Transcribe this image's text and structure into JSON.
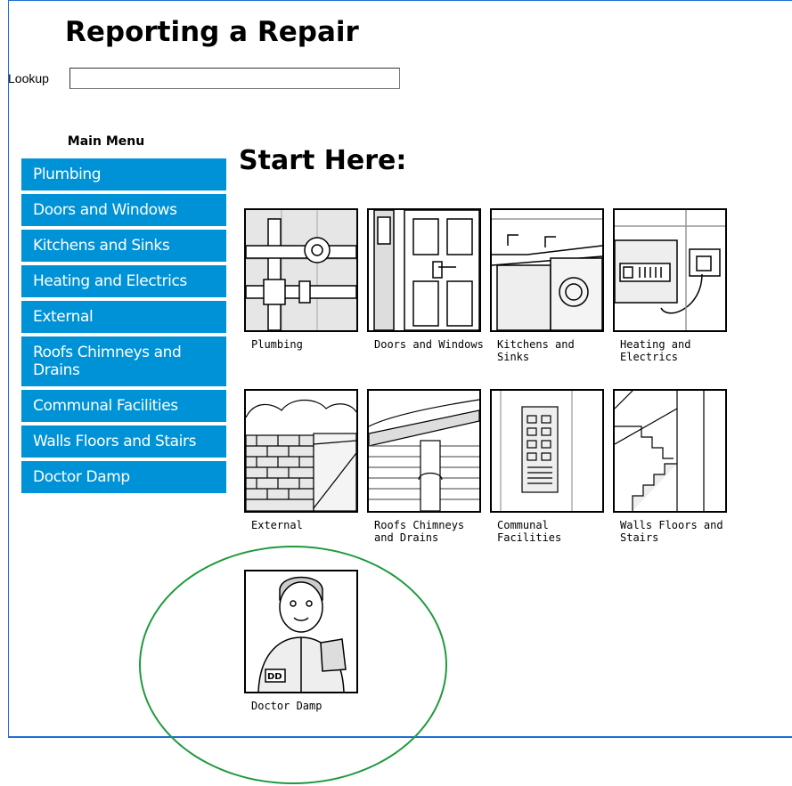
{
  "page": {
    "title": "Reporting a Repair",
    "start_heading": "Start Here:"
  },
  "lookup": {
    "label": "Lookup",
    "value": ""
  },
  "menu": {
    "title": "Main Menu",
    "items": [
      {
        "label": "Plumbing"
      },
      {
        "label": "Doors and Windows"
      },
      {
        "label": "Kitchens and Sinks"
      },
      {
        "label": "Heating and Electrics"
      },
      {
        "label": "External"
      },
      {
        "label": "Roofs Chimneys and Drains"
      },
      {
        "label": "Communal Facilities"
      },
      {
        "label": "Walls Floors and Stairs"
      },
      {
        "label": "Doctor Damp"
      }
    ]
  },
  "tiles": [
    {
      "caption": "Plumbing",
      "icon": "pipes-icon"
    },
    {
      "caption": "Doors and Windows",
      "icon": "door-icon"
    },
    {
      "caption": "Kitchens and Sinks",
      "icon": "kitchen-icon"
    },
    {
      "caption": "Heating and Electrics",
      "icon": "socket-icon"
    },
    {
      "caption": "External",
      "icon": "brick-wall-icon"
    },
    {
      "caption": "Roofs Chimneys and Drains",
      "icon": "gutter-icon"
    },
    {
      "caption": "Communal Facilities",
      "icon": "intercom-icon"
    },
    {
      "caption": "Walls Floors and Stairs",
      "icon": "stairs-icon"
    },
    {
      "caption": "Doctor Damp",
      "icon": "doctor-damp-icon"
    }
  ],
  "colors": {
    "menu_bg": "#0092d6",
    "frame_border": "#1d6fd1",
    "highlight_circle": "#1e9a3c"
  }
}
